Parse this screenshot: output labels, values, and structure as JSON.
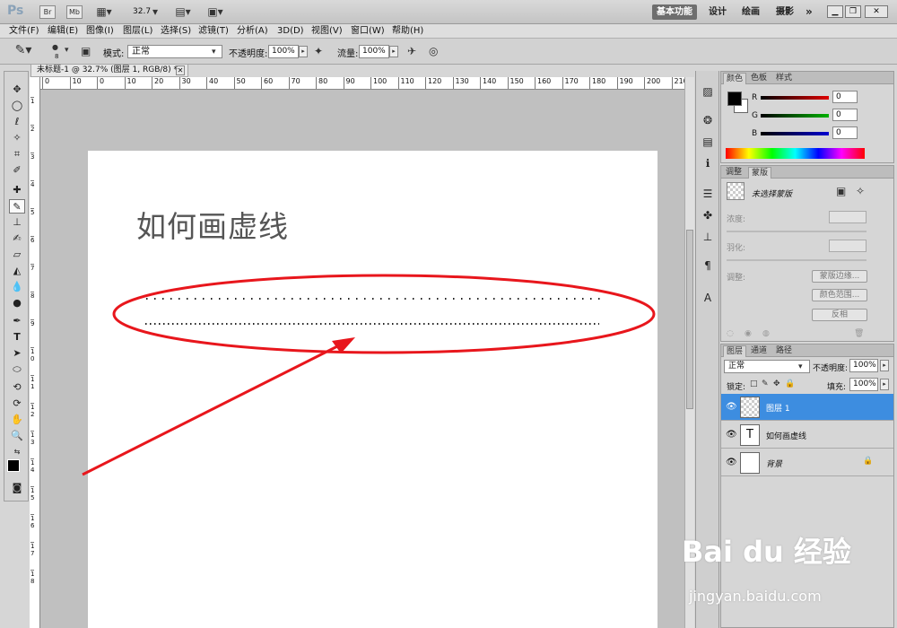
{
  "app": {
    "logo": "Ps",
    "bridge_label": "Br",
    "minibridge_label": "Mb",
    "zoom": "32.7",
    "workspaces": [
      "基本功能",
      "设计",
      "绘画",
      "摄影"
    ],
    "more": "»"
  },
  "menu": [
    "文件(F)",
    "编辑(E)",
    "图像(I)",
    "图层(L)",
    "选择(S)",
    "滤镜(T)",
    "分析(A)",
    "3D(D)",
    "视图(V)",
    "窗口(W)",
    "帮助(H)"
  ],
  "options": {
    "brush_size": "8",
    "mode_label": "模式:",
    "mode_value": "正常",
    "opacity_label": "不透明度:",
    "opacity_value": "100%",
    "flow_label": "流量:",
    "flow_value": "100%"
  },
  "document": {
    "tab_title": "未标题-1 @ 32.7% (图层 1, RGB/8) *",
    "canvas_heading": "如何画虚线",
    "ruler_ticks": [
      "0",
      "10",
      "0",
      "10",
      "20",
      "30",
      "40",
      "50",
      "60",
      "70",
      "80",
      "90",
      "100",
      "110",
      "120",
      "130",
      "140",
      "150",
      "160",
      "170",
      "180",
      "190",
      "200",
      "210"
    ],
    "vruler_ticks": [
      "1",
      "2",
      "3",
      "4",
      "5",
      "6",
      "7",
      "8",
      "9",
      "1\n0",
      "1\n1",
      "1\n2",
      "1\n3",
      "1\n4",
      "1\n5",
      "1\n6",
      "1\n7",
      "1\n8"
    ]
  },
  "color_panel": {
    "tabs": [
      "颜色",
      "色板",
      "样式"
    ],
    "channels": [
      {
        "label": "R",
        "value": "0",
        "color": "#e00000"
      },
      {
        "label": "G",
        "value": "0",
        "color": "#00b000"
      },
      {
        "label": "B",
        "value": "0",
        "color": "#0000d0"
      }
    ]
  },
  "masks_panel": {
    "tabs": [
      "调整",
      "蒙版"
    ],
    "no_mask": "未选择蒙版",
    "density_label": "浓度:",
    "feather_label": "羽化:",
    "refine_label": "调整:",
    "mask_edge_btn": "蒙版边缘...",
    "color_range_btn": "颜色范围...",
    "invert_btn": "反相"
  },
  "layers_panel": {
    "tabs": [
      "图层",
      "通道",
      "路径"
    ],
    "blend_mode": "正常",
    "opacity_label": "不透明度:",
    "opacity_value": "100%",
    "lock_label": "锁定:",
    "fill_label": "填充:",
    "fill_value": "100%",
    "layers": [
      {
        "name": "图层 1",
        "selected": true,
        "thumb": ""
      },
      {
        "name": "如何画虚线",
        "selected": false,
        "thumb": "T"
      },
      {
        "name": "背景",
        "selected": false,
        "thumb": ""
      }
    ]
  },
  "watermark": {
    "brand": "Bai du 经验",
    "url": "jingyan.baidu.com"
  },
  "colors": {
    "annotation_red": "#e8161c",
    "selected_layer": "#3d8de0"
  }
}
